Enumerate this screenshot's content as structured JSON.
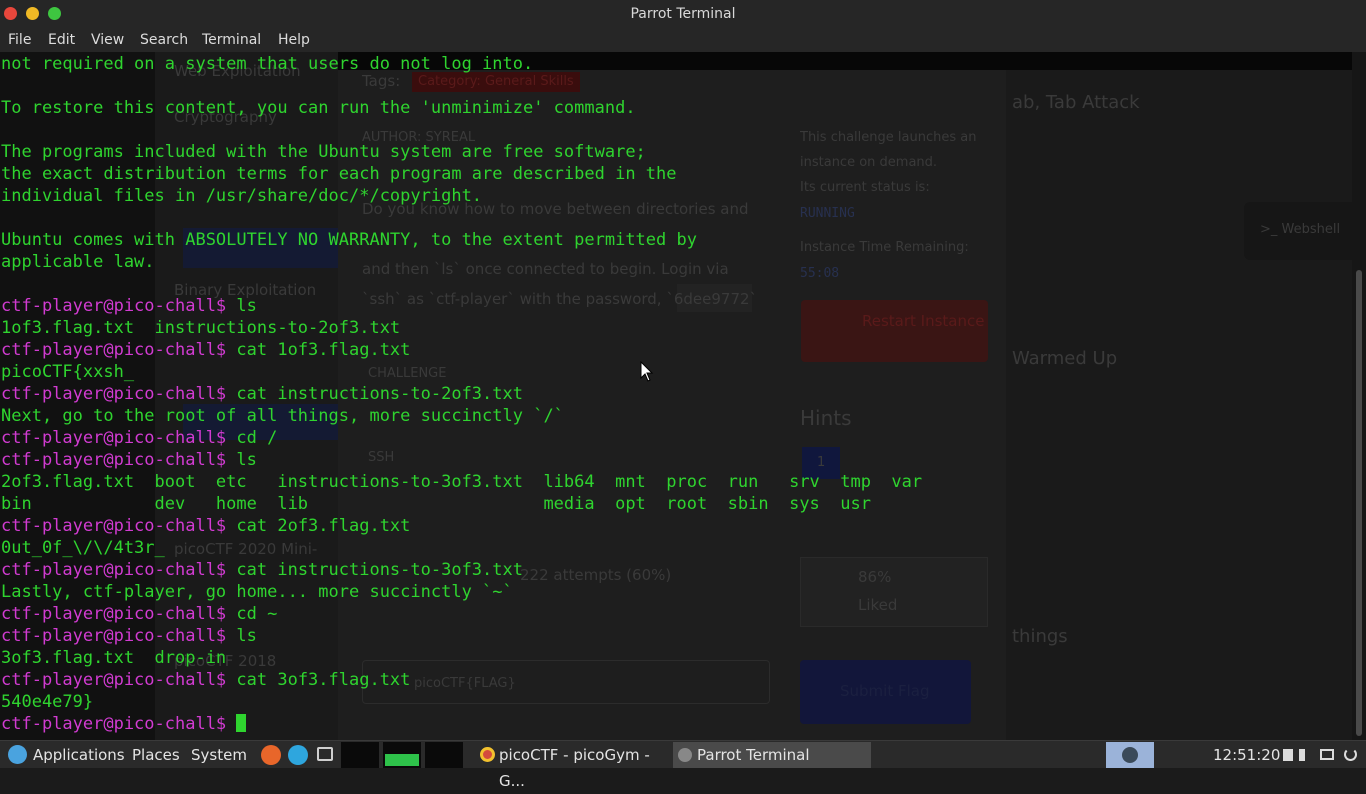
{
  "window": {
    "title": "Parrot Terminal"
  },
  "menu": [
    "File",
    "Edit",
    "View",
    "Search",
    "Terminal",
    "Help"
  ],
  "terminal": {
    "lines": [
      {
        "type": "out",
        "text": "not required on a system that users do not log into."
      },
      {
        "type": "out",
        "text": ""
      },
      {
        "type": "out",
        "text": "To restore this content, you can run the 'unminimize' command."
      },
      {
        "type": "out",
        "text": ""
      },
      {
        "type": "out",
        "text": "The programs included with the Ubuntu system are free software;"
      },
      {
        "type": "out",
        "text": "the exact distribution terms for each program are described in the"
      },
      {
        "type": "out",
        "text": "individual files in /usr/share/doc/*/copyright."
      },
      {
        "type": "out",
        "text": ""
      },
      {
        "type": "out",
        "text": "Ubuntu comes with ABSOLUTELY NO WARRANTY, to the extent permitted by"
      },
      {
        "type": "out",
        "text": "applicable law."
      },
      {
        "type": "out",
        "text": ""
      },
      {
        "type": "cmd",
        "prompt": "ctf-player@pico-chall$",
        "text": " ls"
      },
      {
        "type": "out",
        "text": "1of3.flag.txt  instructions-to-2of3.txt"
      },
      {
        "type": "cmd",
        "prompt": "ctf-player@pico-chall$",
        "text": " cat 1of3.flag.txt"
      },
      {
        "type": "out",
        "text": "picoCTF{xxsh_"
      },
      {
        "type": "cmd",
        "prompt": "ctf-player@pico-chall$",
        "text": " cat instructions-to-2of3.txt"
      },
      {
        "type": "out",
        "text": "Next, go to the root of all things, more succinctly `/`"
      },
      {
        "type": "cmd",
        "prompt": "ctf-player@pico-chall$",
        "text": " cd /"
      },
      {
        "type": "cmd",
        "prompt": "ctf-player@pico-chall$",
        "text": " ls"
      },
      {
        "type": "out",
        "text": "2of3.flag.txt  boot  etc   instructions-to-3of3.txt  lib64  mnt  proc  run   srv  tmp  var"
      },
      {
        "type": "out",
        "text": "bin            dev   home  lib                       media  opt  root  sbin  sys  usr"
      },
      {
        "type": "cmd",
        "prompt": "ctf-player@pico-chall$",
        "text": " cat 2of3.flag.txt"
      },
      {
        "type": "out",
        "text": "0ut_0f_\\/\\/4t3r_"
      },
      {
        "type": "cmd",
        "prompt": "ctf-player@pico-chall$",
        "text": " cat instructions-to-3of3.txt"
      },
      {
        "type": "out",
        "text": "Lastly, ctf-player, go home... more succinctly `~`"
      },
      {
        "type": "cmd",
        "prompt": "ctf-player@pico-chall$",
        "text": " cd ~"
      },
      {
        "type": "cmd",
        "prompt": "ctf-player@pico-chall$",
        "text": " ls"
      },
      {
        "type": "out",
        "text": "3of3.flag.txt  drop-in"
      },
      {
        "type": "cmd",
        "prompt": "ctf-player@pico-chall$",
        "text": " cat 3of3.flag.txt"
      },
      {
        "type": "out",
        "text": "540e4e79}"
      },
      {
        "type": "cmd",
        "prompt": "ctf-player@pico-chall$",
        "text": " ",
        "cursor": true
      }
    ]
  },
  "background_page": {
    "tags_label": "Tags:",
    "tag": "Category: General Skills",
    "author": "AUTHOR: SYREAL",
    "description": "Do you know how to move between directories and",
    "description2": "and then `ls` once connected to begin. Login via",
    "description3": "`ssh` as `ctf-player` with the password, `6dee9772`",
    "status_intro": "This challenge launches an",
    "status_intro2": "instance on demand.",
    "status_label": "Its current status is:",
    "status": "RUNNING",
    "time_label": "Instance Time Remaining:",
    "time": "55:08",
    "restart": "Restart Instance",
    "hints": "Hints",
    "hint_num": "1",
    "challenge": "CHALLENGE",
    "ssh": "SSH",
    "attempts": "222 attempts (60%)",
    "liked_pct": "86%",
    "liked": "Liked",
    "submit": "Submit Flag",
    "flag_placeholder": "picoCTF{FLAG}",
    "webshell": ">_ Webshell",
    "sidebar": [
      "Web Exploitation",
      "Cryptography",
      "Binary Exploitation",
      "picoCTF 2020 Mini-",
      "picoCTF 2018"
    ],
    "right": [
      "ab, Tab Attack",
      "Warmed Up",
      "things"
    ]
  },
  "taskbar": {
    "applications": "Applications",
    "places": "Places",
    "system": "System",
    "tasks": [
      {
        "label": "picoCTF - picoGym - G...",
        "active": false
      },
      {
        "label": "Parrot Terminal",
        "active": true
      }
    ],
    "clock": "12:51:20"
  },
  "colors": {
    "terminal_bg": "#111111",
    "output": "#2fd42f",
    "prompt": "#d13bd1"
  }
}
